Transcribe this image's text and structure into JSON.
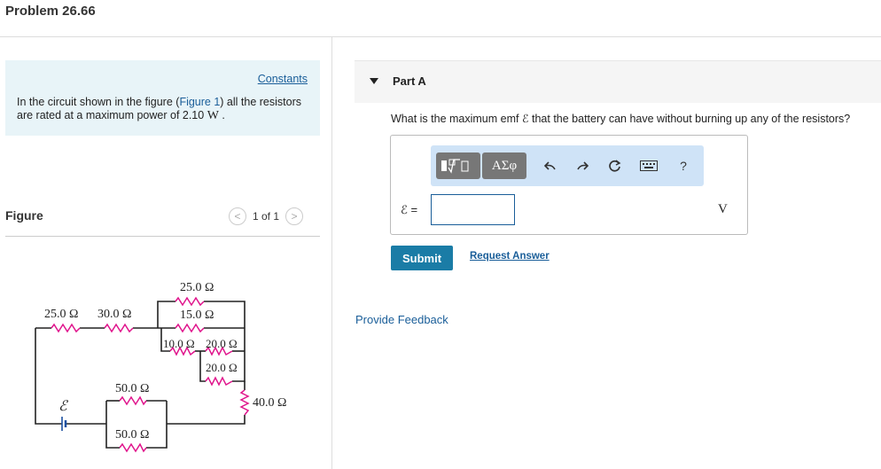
{
  "header": {
    "title": "Problem 26.66"
  },
  "intro": {
    "constants_link": "Constants",
    "text_before": "In the circuit shown in the figure (",
    "figure_link": "Figure 1",
    "text_middle": ") all the resistors are rated at a maximum power of 2.10 ",
    "unit": "W",
    "text_end": " ."
  },
  "figure": {
    "label": "Figure",
    "pager_text": "1 of 1",
    "resistors": {
      "left1": "25.0 Ω",
      "left2": "30.0 Ω",
      "top_upper": "25.0 Ω",
      "top_lower": "15.0 Ω",
      "mid_left": "10.0 Ω",
      "mid_right": "20.0 Ω",
      "mid_lower": "20.0 Ω",
      "right": "40.0 Ω",
      "bottom_upper": "50.0 Ω",
      "bottom_lower": "50.0 Ω"
    },
    "emf_symbol": "ℰ"
  },
  "part_a": {
    "label": "Part A",
    "question": "What is the maximum emf ℰ that the battery can have without burning up any of the resistors?",
    "answer_label": "ℰ =",
    "answer_value": "",
    "unit": "V",
    "toolbar": {
      "greek": "ΑΣφ",
      "help": "?"
    },
    "submit_label": "Submit",
    "request_answer_label": "Request Answer"
  },
  "feedback_label": "Provide Feedback"
}
